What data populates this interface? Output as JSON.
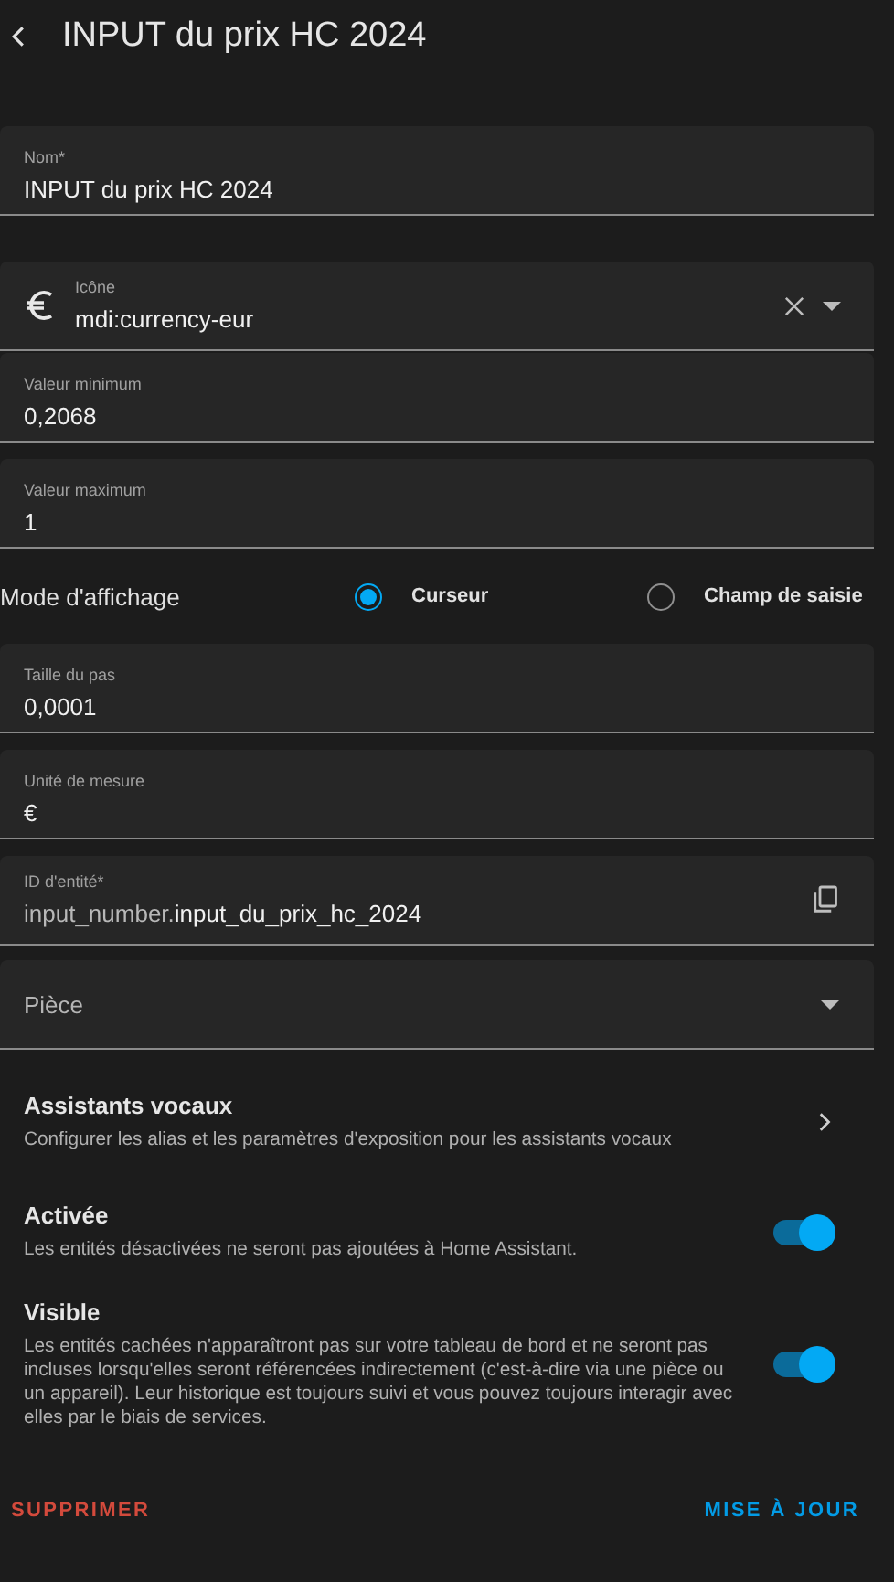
{
  "header": {
    "title": "INPUT du prix HC 2024"
  },
  "name_field": {
    "label": "Nom*",
    "value": "INPUT du prix HC 2024"
  },
  "icon_field": {
    "label": "Icône",
    "value": "mdi:currency-eur"
  },
  "range_fields": [
    {
      "label": "Valeur minimum",
      "value": "0,2068"
    },
    {
      "label": "Valeur maximum",
      "value": "1"
    }
  ],
  "display_mode": {
    "label": "Mode d'affichage",
    "options": [
      {
        "label": "Curseur",
        "selected": true
      },
      {
        "label": "Champ de saisie",
        "selected": false
      }
    ]
  },
  "unit_fields": [
    {
      "label": "Taille du pas",
      "value": "0,0001"
    },
    {
      "label": "Unité de mesure",
      "value": "€"
    }
  ],
  "entity_id": {
    "label": "ID d'entité*",
    "prefix": "input_number.",
    "value": "input_du_prix_hc_2024"
  },
  "area_field": {
    "placeholder": "Pièce"
  },
  "voice_assistants": {
    "title": "Assistants vocaux",
    "description": "Configurer les alias et les paramètres d'exposition pour les assistants vocaux"
  },
  "toggles": [
    {
      "title": "Activée",
      "description": "Les entités désactivées ne seront pas ajoutées à Home Assistant.",
      "on": true
    },
    {
      "title": "Visible",
      "description": "Les entités cachées n'apparaîtront pas sur votre tableau de bord et ne seront pas incluses lorsqu'elles seront référencées indirectement (c'est-à-dire via une pièce ou un appareil). Leur historique est toujours suivi et vous pouvez toujours interagir avec elles par le biais de services.",
      "on": true
    }
  ],
  "buttons": {
    "delete": "SUPPRIMER",
    "update": "MISE À JOUR"
  }
}
